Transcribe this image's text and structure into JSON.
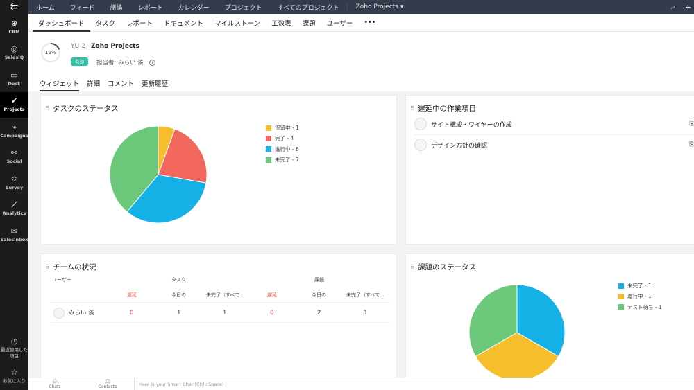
{
  "rail": {
    "items": [
      {
        "label": "CRM",
        "icon": "crm-icon",
        "glyph": "⊕"
      },
      {
        "label": "SalesIQ",
        "icon": "salesiq-icon",
        "glyph": "◎"
      },
      {
        "label": "Desk",
        "icon": "desk-icon",
        "glyph": "▭"
      },
      {
        "label": "Projects",
        "icon": "projects-icon",
        "glyph": "✔"
      },
      {
        "label": "Campaigns",
        "icon": "campaigns-icon",
        "glyph": "⌁"
      },
      {
        "label": "Social",
        "icon": "social-icon",
        "glyph": "⚯"
      },
      {
        "label": "Survey",
        "icon": "survey-icon",
        "glyph": "✩"
      },
      {
        "label": "Analytics",
        "icon": "analytics-icon",
        "glyph": "⟋"
      },
      {
        "label": "SalesInbox",
        "icon": "salesinbox-icon",
        "glyph": "✉"
      }
    ],
    "recent_label_1": "最近使用した",
    "recent_label_2": "項目",
    "favorites_label": "お気に入り"
  },
  "topnav": {
    "items": [
      "ホーム",
      "フィード",
      "議論",
      "レポート",
      "カレンダー",
      "プロジェクト",
      "すべてのプロジェクト"
    ],
    "project_selector": "Zoho Projects ▾"
  },
  "subnav": {
    "items": [
      "ダッシュボード",
      "タスク",
      "レポート",
      "ドキュメント",
      "マイルストーン",
      "工数表",
      "課題",
      "ユーザー",
      "•••"
    ]
  },
  "header": {
    "progress_percent": 19,
    "progress_label": "19%",
    "project_id": "YU-2",
    "project_name": "Zoho Projects",
    "status_badge": "有効",
    "owner": "担当者: みらい 湊",
    "info_glyph": "i",
    "tabs": [
      "ウィジェット",
      "詳細",
      "コメント",
      "更新履歴"
    ]
  },
  "task_status": {
    "title": "タスクのステータス",
    "legend": [
      {
        "label": "保留中 - 1",
        "color": "#f6be2c"
      },
      {
        "label": "完了 - 4",
        "color": "#f2685f"
      },
      {
        "label": "進行中 - 6",
        "color": "#14b0e6"
      },
      {
        "label": "未完了 - 7",
        "color": "#6cc97b"
      }
    ]
  },
  "delayed": {
    "title": "遅延中の作業項目",
    "items": [
      "サイト構成・ワイヤーの作成",
      "デザイン方針の確認"
    ]
  },
  "team": {
    "title": "チームの状況",
    "col_user": "ユーザー",
    "col_tasks": "タスク",
    "col_issues": "課題",
    "sub_delayed": "遅延",
    "sub_today": "今日の",
    "sub_open": "未完了（すべて...",
    "rows": [
      {
        "user": "みらい 湊",
        "t_delayed": "0",
        "t_today": "1",
        "t_open": "1",
        "i_delayed": "0",
        "i_today": "2",
        "i_open": "3"
      }
    ]
  },
  "issue_status": {
    "title": "課題のステータス",
    "legend": [
      {
        "label": "未完了 - 1",
        "color": "#14b0e6"
      },
      {
        "label": "進行中 - 1",
        "color": "#f6be2c"
      },
      {
        "label": "テスト待ち - 1",
        "color": "#6cc97b"
      }
    ]
  },
  "chart_data": [
    {
      "type": "pie",
      "title": "タスクのステータス",
      "categories": [
        "保留中",
        "完了",
        "進行中",
        "未完了"
      ],
      "values": [
        1,
        4,
        6,
        7
      ],
      "colors": [
        "#f6be2c",
        "#f2685f",
        "#14b0e6",
        "#6cc97b"
      ],
      "legend": "right"
    },
    {
      "type": "pie",
      "title": "課題のステータス",
      "categories": [
        "未完了",
        "進行中",
        "テスト待ち"
      ],
      "values": [
        1,
        1,
        1
      ],
      "colors": [
        "#14b0e6",
        "#f6be2c",
        "#6cc97b"
      ],
      "legend": "right"
    }
  ],
  "bottombar": {
    "chats_label": "Chats",
    "contacts_label": "Contacts",
    "smartchat_placeholder": "Here is your Smart Chat (Ctrl+Space)"
  }
}
